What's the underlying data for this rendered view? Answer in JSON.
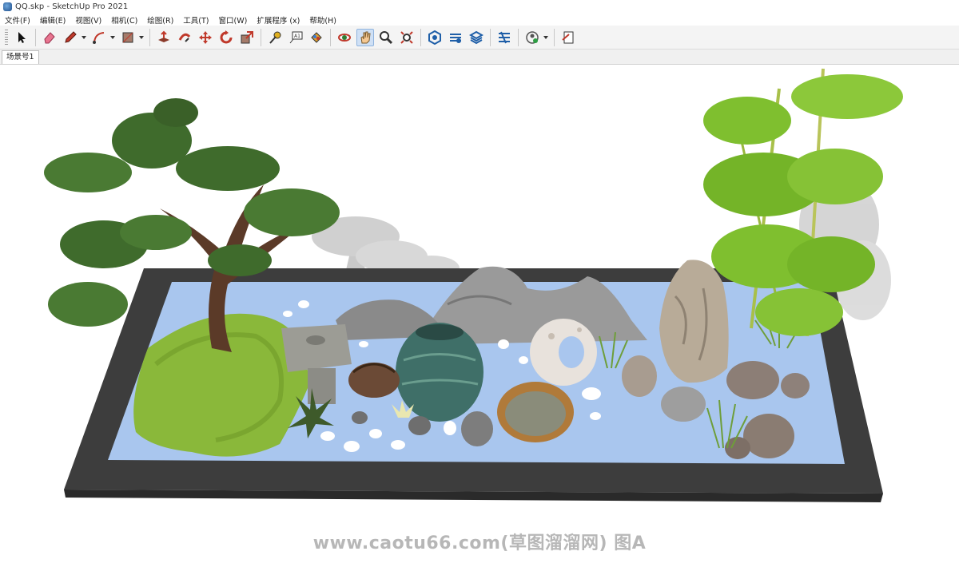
{
  "window": {
    "title": "QQ.skp - SketchUp Pro 2021"
  },
  "menu": {
    "items": [
      "文件(F)",
      "编辑(E)",
      "视图(V)",
      "相机(C)",
      "绘图(R)",
      "工具(T)",
      "窗口(W)",
      "扩展程序 (x)",
      "帮助(H)"
    ]
  },
  "toolbar": {
    "tools": [
      "select-icon",
      "eraser-icon",
      "pencil-icon",
      "arc-icon",
      "rectangle-icon",
      "push-pull-icon",
      "follow-me-icon",
      "move-icon",
      "rotate-icon",
      "scale-icon",
      "tape-measure-icon",
      "text-icon",
      "paint-bucket-icon",
      "orbit-icon",
      "pan-icon",
      "zoom-icon",
      "zoom-extents-icon",
      "warehouse-icon",
      "extension-warehouse-icon",
      "layout-icon",
      "sandbox-icon",
      "account-icon",
      "send-to-layout-icon"
    ],
    "active_tool": "pan-icon"
  },
  "scenes": {
    "tabs": [
      "场景号1"
    ]
  },
  "watermark": {
    "text": "www.caotu66.com(草图溜溜网) 图A"
  },
  "colors": {
    "water": "#a9c6ee",
    "frame": "#3d3d3d",
    "grass": "#8ab83a",
    "rock": "#9a9a9a",
    "pine": "#3f6b2c",
    "bamboo": "#7fbf2f"
  }
}
